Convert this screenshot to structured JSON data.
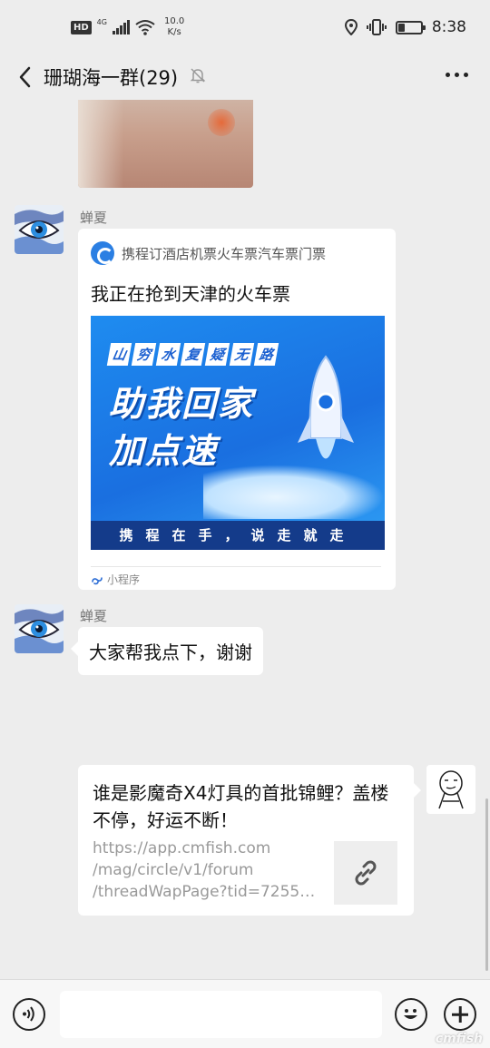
{
  "status_bar": {
    "hd": "HD",
    "network": "4G",
    "speed_value": "10.0",
    "speed_unit": "K/s",
    "battery_level": 0.3,
    "time": "8:38"
  },
  "header": {
    "title": "珊瑚海一群(29)",
    "back_icon": "chevron-left-icon",
    "mute_icon": "bell-off-icon",
    "more_icon": "more-dots-icon"
  },
  "messages": {
    "m1": {
      "sender": "蝉夏",
      "source": "携程订酒店机票火车票汽车票门票",
      "title": "我正在抢到天津的火车票",
      "banner": {
        "ribbon": [
          "山",
          "穷",
          "水",
          "复",
          "疑",
          "无",
          "路"
        ],
        "line1": "助我回家",
        "line2": "加点速",
        "bottom": "携程在手，说走就走"
      },
      "footer": "小程序"
    },
    "m2": {
      "sender": "蝉夏",
      "text": "大家帮我点下，谢谢"
    },
    "m3": {
      "title": "谁是影魔奇X4灯具的首批锦鲤？盖楼不停，好运不断！",
      "url_lines": [
        "https://app.cmfish.com",
        "/mag/circle/v1/forum",
        "/threadWapPage?tid=72558..."
      ],
      "thumb_icon": "link-icon"
    }
  },
  "input_bar": {
    "voice_icon": "voice-icon",
    "emoji_icon": "emoji-icon",
    "plus_icon": "plus-icon",
    "input_value": ""
  },
  "watermark": "cmfish"
}
